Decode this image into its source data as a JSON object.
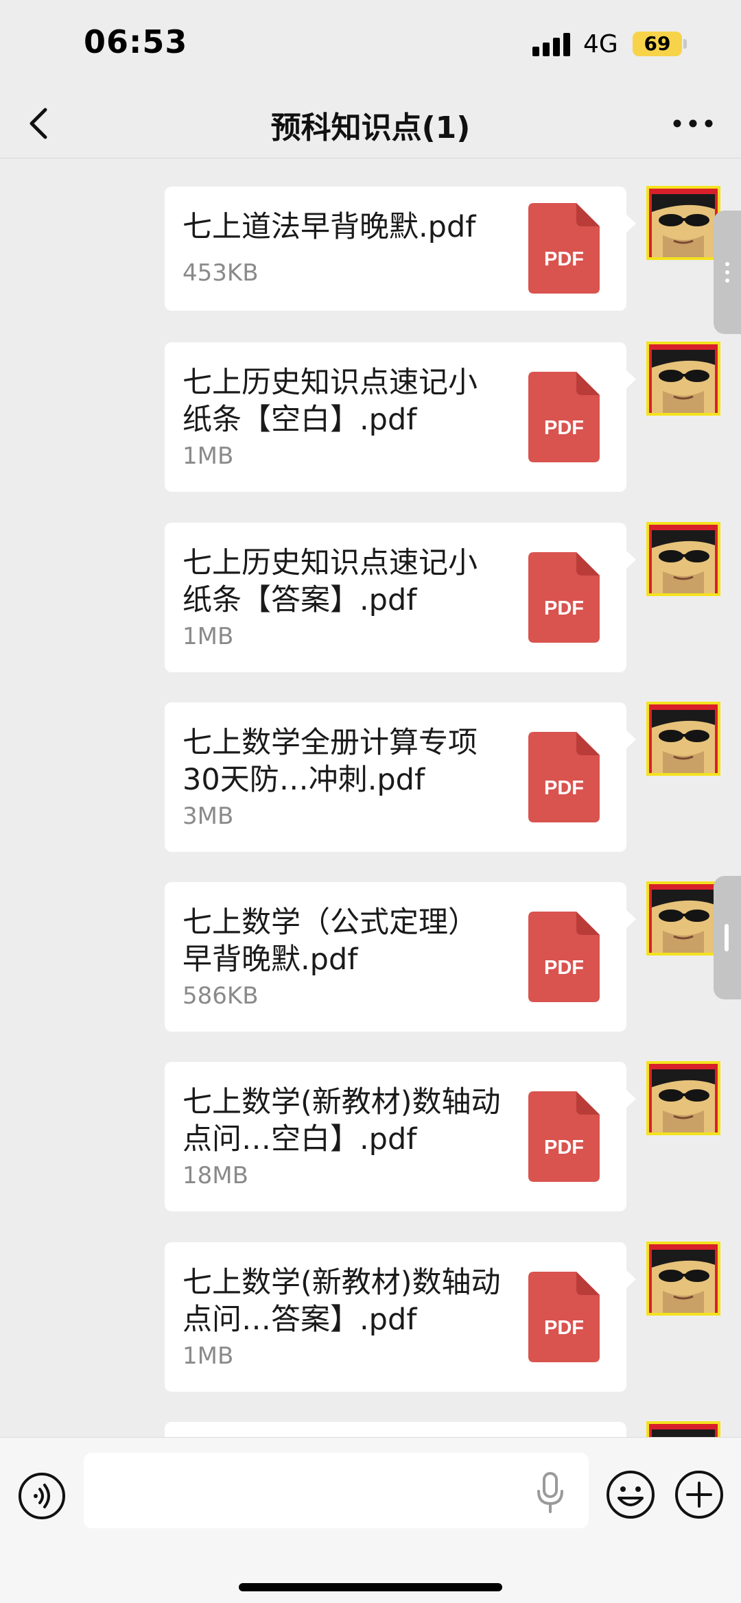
{
  "status_bar": {
    "time": "06:53",
    "network": "4G",
    "battery": "69"
  },
  "nav": {
    "title": "预科知识点(1)"
  },
  "messages": [
    {
      "name": "七上道法早背晚默.pdf",
      "size": "453KB",
      "icon_label": "PDF"
    },
    {
      "name": "七上历史知识点速记小纸条【空白】.pdf",
      "size": "1MB",
      "icon_label": "PDF"
    },
    {
      "name": "七上历史知识点速记小纸条【答案】.pdf",
      "size": "1MB",
      "icon_label": "PDF"
    },
    {
      "name": "七上数学全册计算专项30天防…冲刺.pdf",
      "size": "3MB",
      "icon_label": "PDF"
    },
    {
      "name": "七上数学（公式定理）早背晚默.pdf",
      "size": "586KB",
      "icon_label": "PDF"
    },
    {
      "name": "七上数学(新教材)数轴动点问…空白】.pdf",
      "size": "18MB",
      "icon_label": "PDF"
    },
    {
      "name": "七上数学(新教材)数轴动点问…答案】.pdf",
      "size": "1MB",
      "icon_label": "PDF"
    }
  ],
  "colors": {
    "background": "#ededed",
    "bubble": "#ffffff",
    "pdf_icon": "#d9534f",
    "pdf_fold": "#b93c39",
    "battery": "#f7d34a"
  },
  "icons": {
    "back": "chevron-left-icon",
    "more": "more-dots-icon",
    "voice": "voice-icon",
    "mic": "microphone-icon",
    "emoji": "smile-icon",
    "plus": "plus-icon",
    "file": "pdf-file-icon"
  }
}
